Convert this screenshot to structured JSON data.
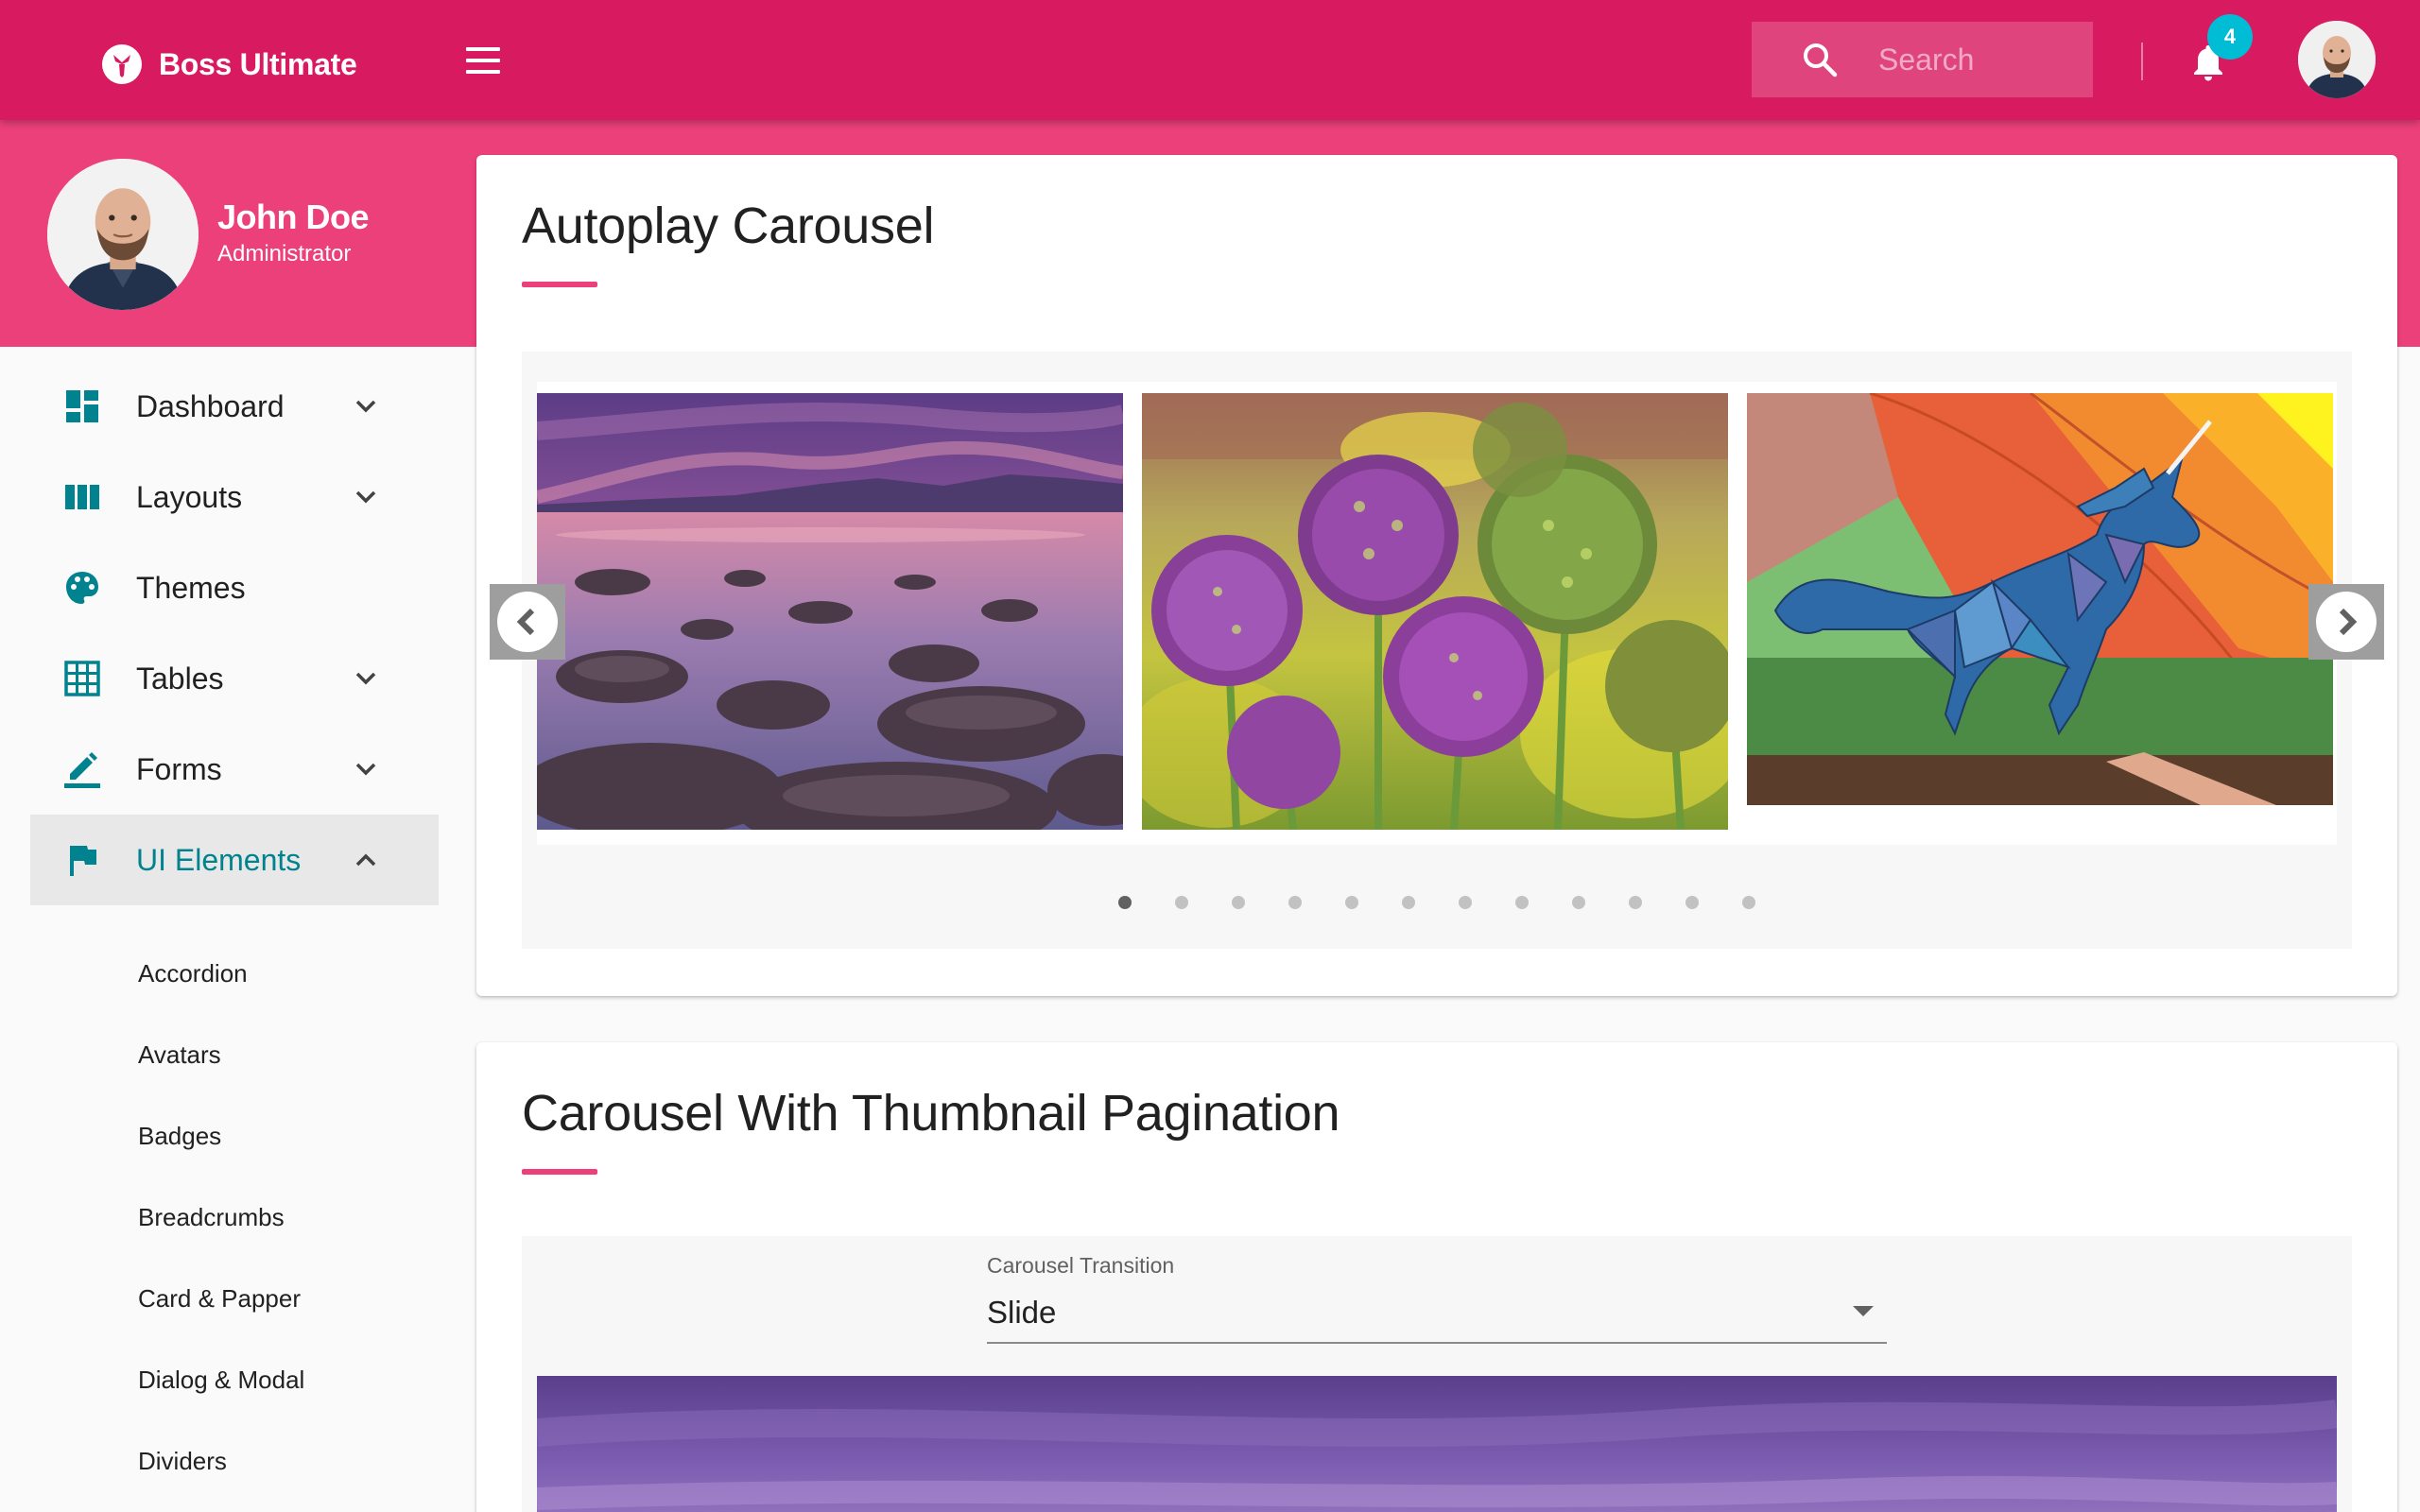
{
  "app": {
    "brand": "Boss Ultimate",
    "search_placeholder": "Search",
    "notification_count": "4"
  },
  "colors": {
    "primary": "#d81b60",
    "accent_pink": "#ec407a",
    "active_teal": "#00838f",
    "badge_cyan": "#00bcd4"
  },
  "profile": {
    "name": "John Doe",
    "role": "Administrator"
  },
  "sidebar": {
    "items": [
      {
        "label": "Dashboard",
        "icon": "dashboard-icon",
        "expandable": true,
        "expanded": false
      },
      {
        "label": "Layouts",
        "icon": "view-column-icon",
        "expandable": true,
        "expanded": false
      },
      {
        "label": "Themes",
        "icon": "palette-icon",
        "expandable": false
      },
      {
        "label": "Tables",
        "icon": "grid-icon",
        "expandable": true,
        "expanded": false
      },
      {
        "label": "Forms",
        "icon": "pencil-icon",
        "expandable": true,
        "expanded": false
      },
      {
        "label": "UI Elements",
        "icon": "flag-icon",
        "expandable": true,
        "expanded": true,
        "active": true
      }
    ],
    "sub_items": [
      "Accordion",
      "Avatars",
      "Badges",
      "Breadcrumbs",
      "Card & Papper",
      "Dialog & Modal",
      "Dividers"
    ]
  },
  "main": {
    "autoplay": {
      "title": "Autoplay Carousel",
      "slides": [
        "sunset-lake-rocks",
        "purple-allium-flowers",
        "geometric-unicorn"
      ],
      "dot_count": 12,
      "active_dot": 0
    },
    "thumbnail": {
      "title": "Carousel With Thumbnail Pagination",
      "select_label": "Carousel Transition",
      "select_value": "Slide"
    }
  }
}
